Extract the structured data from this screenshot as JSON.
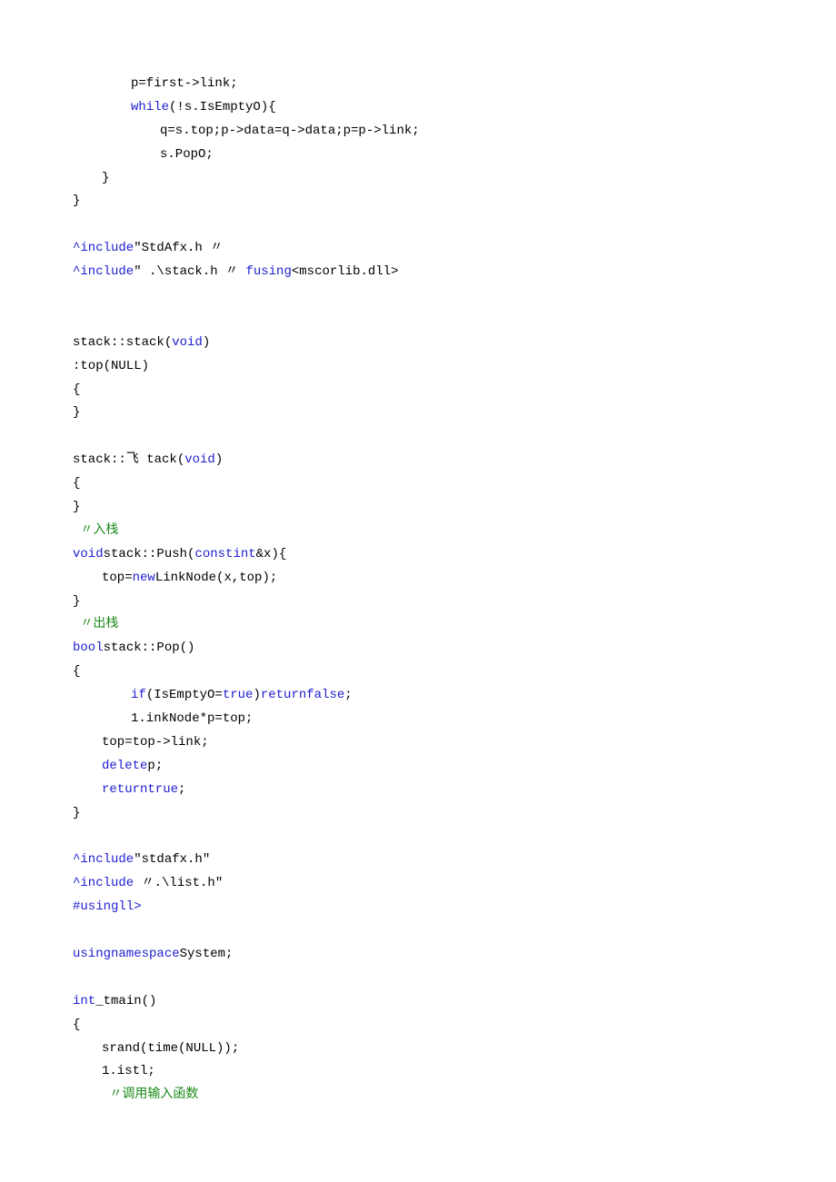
{
  "lines": [
    {
      "indent": 2,
      "segments": [
        {
          "t": "p=first->link;"
        }
      ]
    },
    {
      "indent": 2,
      "segments": [
        {
          "t": "while",
          "c": "kw"
        },
        {
          "t": "(!s.IsEmptyO){"
        }
      ]
    },
    {
      "indent": 3,
      "segments": [
        {
          "t": "q=s.top;p->data=q->data;p=p->link;"
        }
      ]
    },
    {
      "indent": 3,
      "segments": [
        {
          "t": "s.PopO;"
        }
      ]
    },
    {
      "indent": 1,
      "segments": [
        {
          "t": "}"
        }
      ]
    },
    {
      "indent": 0,
      "segments": [
        {
          "t": "}"
        }
      ]
    },
    {
      "indent": 0,
      "segments": [
        {
          "t": ""
        }
      ]
    },
    {
      "indent": 0,
      "segments": [
        {
          "t": "^include",
          "c": "kw"
        },
        {
          "t": "\"StdAfx.h 〃"
        }
      ]
    },
    {
      "indent": 0,
      "segments": [
        {
          "t": "^include",
          "c": "kw"
        },
        {
          "t": "\" .\\stack.h 〃 "
        },
        {
          "t": "fusing",
          "c": "kw"
        },
        {
          "t": "<mscorlib.dll>"
        }
      ]
    },
    {
      "indent": 0,
      "segments": [
        {
          "t": ""
        }
      ]
    },
    {
      "indent": 0,
      "segments": [
        {
          "t": ""
        }
      ]
    },
    {
      "indent": 0,
      "segments": [
        {
          "t": "stack::stack("
        },
        {
          "t": "void",
          "c": "kw"
        },
        {
          "t": ")"
        }
      ]
    },
    {
      "indent": 0,
      "segments": [
        {
          "t": ":top(NULL)"
        }
      ]
    },
    {
      "indent": 0,
      "segments": [
        {
          "t": "{"
        }
      ]
    },
    {
      "indent": 0,
      "segments": [
        {
          "t": "}"
        }
      ]
    },
    {
      "indent": 0,
      "segments": [
        {
          "t": ""
        }
      ]
    },
    {
      "indent": 0,
      "segments": [
        {
          "t": "stack::飞 tack("
        },
        {
          "t": "void",
          "c": "kw"
        },
        {
          "t": ")"
        }
      ]
    },
    {
      "indent": 0,
      "segments": [
        {
          "t": "{"
        }
      ]
    },
    {
      "indent": 0,
      "segments": [
        {
          "t": "}"
        }
      ]
    },
    {
      "indent": 0,
      "segments": [
        {
          "t": " 〃入栈",
          "c": "comment"
        }
      ]
    },
    {
      "indent": 0,
      "segments": [
        {
          "t": "void",
          "c": "kw"
        },
        {
          "t": "stack::Push("
        },
        {
          "t": "constint",
          "c": "kw"
        },
        {
          "t": "&x){"
        }
      ]
    },
    {
      "indent": 1,
      "segments": [
        {
          "t": "top="
        },
        {
          "t": "new",
          "c": "kw"
        },
        {
          "t": "LinkNode(x,top);"
        }
      ]
    },
    {
      "indent": 0,
      "segments": [
        {
          "t": "}"
        }
      ]
    },
    {
      "indent": 0,
      "segments": [
        {
          "t": " 〃出栈",
          "c": "comment"
        }
      ]
    },
    {
      "indent": 0,
      "segments": [
        {
          "t": "bool",
          "c": "kw"
        },
        {
          "t": "stack::Pop()"
        }
      ]
    },
    {
      "indent": 0,
      "segments": [
        {
          "t": "{"
        }
      ]
    },
    {
      "indent": 2,
      "segments": [
        {
          "t": "if",
          "c": "kw"
        },
        {
          "t": "(IsEmptyO="
        },
        {
          "t": "true",
          "c": "kw"
        },
        {
          "t": ")"
        },
        {
          "t": "returnfalse",
          "c": "kw"
        },
        {
          "t": ";"
        }
      ]
    },
    {
      "indent": 2,
      "segments": [
        {
          "t": "1.inkNode*p=top;"
        }
      ]
    },
    {
      "indent": 1,
      "segments": [
        {
          "t": "top=top->link;"
        }
      ]
    },
    {
      "indent": 1,
      "segments": [
        {
          "t": "delete",
          "c": "kw"
        },
        {
          "t": "p;"
        }
      ]
    },
    {
      "indent": 1,
      "segments": [
        {
          "t": "returntrue",
          "c": "kw"
        },
        {
          "t": ";"
        }
      ]
    },
    {
      "indent": 0,
      "segments": [
        {
          "t": "}"
        }
      ]
    },
    {
      "indent": 0,
      "segments": [
        {
          "t": ""
        }
      ]
    },
    {
      "indent": 0,
      "segments": [
        {
          "t": "^include",
          "c": "kw"
        },
        {
          "t": "\"stdafx.h\""
        }
      ]
    },
    {
      "indent": 0,
      "segments": [
        {
          "t": "^include ",
          "c": "kw"
        },
        {
          "t": "〃.\\list.h\""
        }
      ]
    },
    {
      "indent": 0,
      "segments": [
        {
          "t": "#usingll>",
          "c": "kw"
        }
      ]
    },
    {
      "indent": 0,
      "segments": [
        {
          "t": ""
        }
      ]
    },
    {
      "indent": 0,
      "segments": [
        {
          "t": "usingnamespace",
          "c": "kw"
        },
        {
          "t": "System;"
        }
      ]
    },
    {
      "indent": 0,
      "segments": [
        {
          "t": ""
        }
      ]
    },
    {
      "indent": 0,
      "segments": [
        {
          "t": "int",
          "c": "kw"
        },
        {
          "t": "_tmain()"
        }
      ]
    },
    {
      "indent": 0,
      "segments": [
        {
          "t": "{"
        }
      ]
    },
    {
      "indent": 1,
      "segments": [
        {
          "t": "srand(time(NULL));"
        }
      ]
    },
    {
      "indent": 1,
      "segments": [
        {
          "t": "1.istl;"
        }
      ]
    },
    {
      "indent": 1,
      "segments": [
        {
          "t": " 〃调用输入函数",
          "c": "comment"
        }
      ]
    }
  ]
}
